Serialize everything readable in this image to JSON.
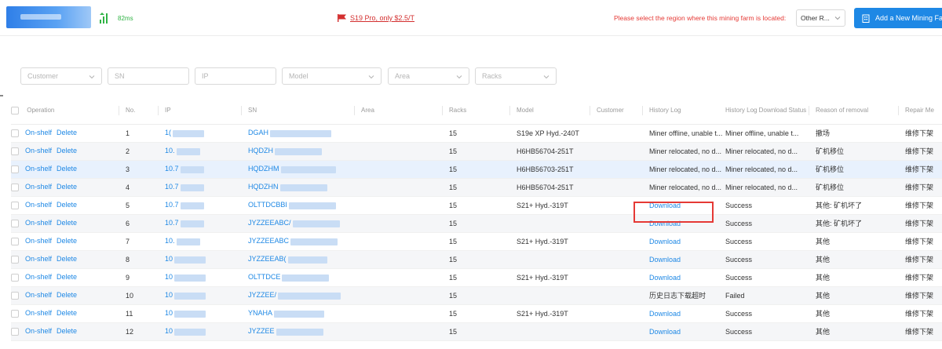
{
  "header": {
    "latency": "82ms",
    "promo": "S19 Pro, only $2.5/T",
    "region_prompt": "Please select the region where this mining farm is located:",
    "region_value": "Other R...",
    "add_button": "Add a New Mining Fa",
    "colors": {
      "primary": "#1e88e5",
      "danger": "#e53935",
      "success": "#2fb344"
    }
  },
  "filters": {
    "customer": "Customer",
    "sn": "SN",
    "ip": "IP",
    "model": "Model",
    "area": "Area",
    "racks": "Racks"
  },
  "table": {
    "columns": {
      "operation": "Operation",
      "no": "No.",
      "ip": "IP",
      "sn": "SN",
      "area": "Area",
      "racks": "Racks",
      "model": "Model",
      "customer": "Customer",
      "history_log": "History Log",
      "history_status": "History Log Download Status",
      "reason": "Reason of removal",
      "repair": "Repair Me"
    },
    "actions": {
      "on_shelf": "On-shelf",
      "delete": "Delete"
    },
    "rows": [
      {
        "no": "1",
        "ip": "1(",
        "sn": "DGAH",
        "racks": "15",
        "model": "S19e XP Hyd.-240T",
        "log": "Miner offline, unable t...",
        "status": "Miner offline, unable t...",
        "reason": "撤场",
        "repair": "维修下架"
      },
      {
        "no": "2",
        "ip": "10.",
        "sn": "HQDZH",
        "racks": "15",
        "model": "H6HB56704-251T",
        "log": "Miner relocated, no d...",
        "status": "Miner relocated, no d...",
        "reason": "矿机移位",
        "repair": "维修下架"
      },
      {
        "no": "3",
        "ip": "10.7",
        "sn": "HQDZHM",
        "racks": "15",
        "model": "H6HB56703-251T",
        "log": "Miner relocated, no d...",
        "status": "Miner relocated, no d...",
        "reason": "矿机移位",
        "repair": "维修下架"
      },
      {
        "no": "4",
        "ip": "10.7",
        "sn": "HQDZHN",
        "racks": "15",
        "model": "H6HB56704-251T",
        "log": "Miner relocated, no d...",
        "status": "Miner relocated, no d...",
        "reason": "矿机移位",
        "repair": "维修下架"
      },
      {
        "no": "5",
        "ip": "10.7",
        "sn": "OLTTDCBBI",
        "racks": "15",
        "model": "S21+ Hyd.-319T",
        "log": "Download",
        "status": "Success",
        "reason": "其他: 矿机坏了",
        "repair": "维修下架"
      },
      {
        "no": "6",
        "ip": "10.7",
        "sn": "JYZZEEABC/",
        "racks": "15",
        "model": "",
        "log": "Download",
        "status": "Success",
        "reason": "其他: 矿机坏了",
        "repair": "维修下架"
      },
      {
        "no": "7",
        "ip": "10.",
        "sn": "JYZZEEABC",
        "racks": "15",
        "model": "S21+ Hyd.-319T",
        "log": "Download",
        "status": "Success",
        "reason": "其他",
        "repair": "维修下架"
      },
      {
        "no": "8",
        "ip": "10",
        "sn": "JYZZEEAB(",
        "racks": "15",
        "model": "",
        "log": "Download",
        "status": "Success",
        "reason": "其他",
        "repair": "维修下架"
      },
      {
        "no": "9",
        "ip": "10",
        "sn": "OLTTDCE",
        "racks": "15",
        "model": "S21+ Hyd.-319T",
        "log": "Download",
        "status": "Success",
        "reason": "其他",
        "repair": "维修下架"
      },
      {
        "no": "10",
        "ip": "10",
        "sn": "JYZZEE/",
        "racks": "15",
        "model": "",
        "log": "历史日志下载超时",
        "status": "Failed",
        "reason": "其他",
        "repair": "维修下架"
      },
      {
        "no": "11",
        "ip": "10",
        "sn": "YNAHA",
        "racks": "15",
        "model": "S21+ Hyd.-319T",
        "log": "Download",
        "status": "Success",
        "reason": "其他",
        "repair": "维修下架"
      },
      {
        "no": "12",
        "ip": "10",
        "sn": "JYZZEE",
        "racks": "15",
        "model": "",
        "log": "Download",
        "status": "Success",
        "reason": "其他",
        "repair": "维修下架"
      }
    ]
  }
}
